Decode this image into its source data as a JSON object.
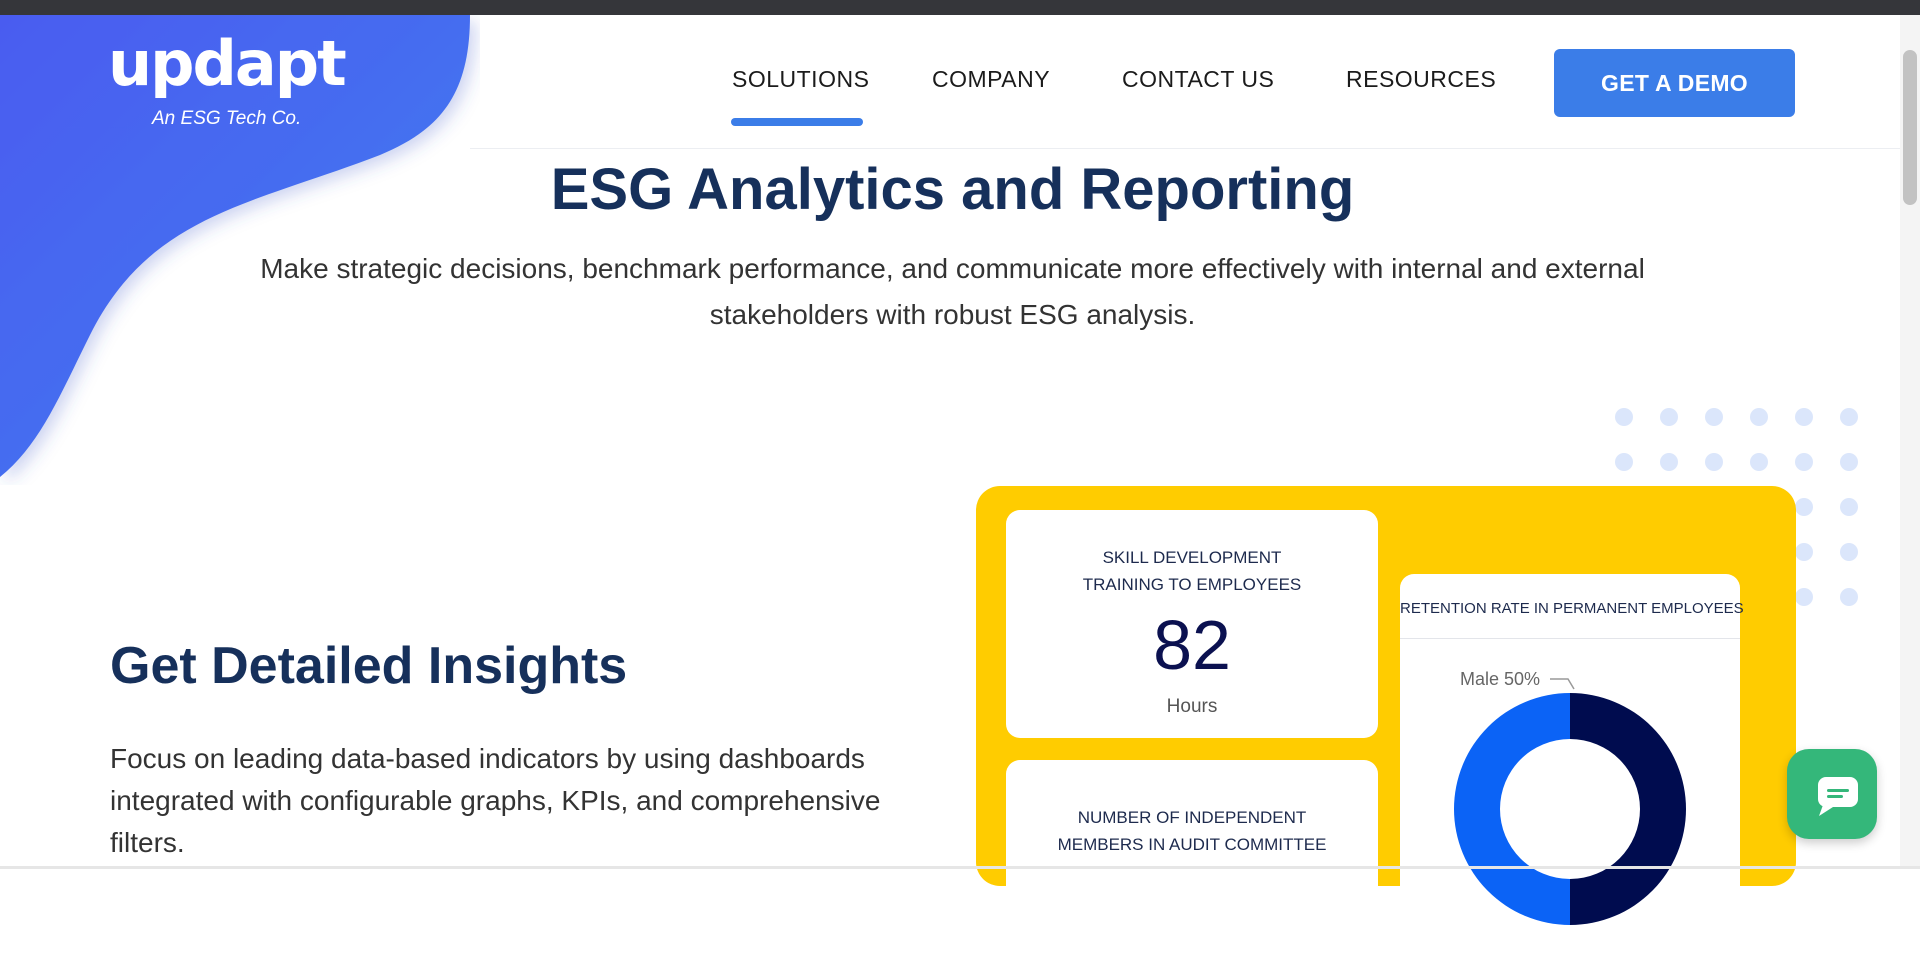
{
  "brand": {
    "logo_text": "updapt",
    "tagline": "An ESG Tech Co."
  },
  "nav": {
    "items": [
      {
        "label": "SOLUTIONS",
        "active": true
      },
      {
        "label": "COMPANY"
      },
      {
        "label": "CONTACT US"
      },
      {
        "label": "RESOURCES"
      }
    ],
    "cta_label": "GET A DEMO"
  },
  "hero": {
    "title": "ESG Analytics and Reporting",
    "subtitle": "Make strategic decisions, benchmark performance, and communicate more effectively with internal and external stakeholders with robust ESG analysis."
  },
  "section": {
    "title": "Get Detailed Insights",
    "description": "Focus on leading data-based indicators by using dashboards integrated with configurable graphs, KPIs, and comprehensive filters."
  },
  "dashboard": {
    "kpi_card": {
      "title": "SKILL DEVELOPMENT TRAINING TO EMPLOYEES",
      "value": "82",
      "unit": "Hours"
    },
    "members_card": {
      "title": "NUMBER OF INDEPENDENT MEMBERS IN AUDIT COMMITTEE"
    },
    "retention_card": {
      "title": "RETENTION RATE IN PERMANENT EMPLOYEES",
      "slice_label": "Male 50%"
    }
  },
  "chart_data": {
    "type": "pie",
    "title": "RETENTION RATE IN PERMANENT EMPLOYEES",
    "slices": [
      {
        "label": "Male",
        "value": 50,
        "color": "#000c4f"
      },
      {
        "value": 50,
        "color": "#0b63f6"
      }
    ]
  },
  "colors": {
    "brand_blue": "#3b7de8",
    "navy": "#16305b",
    "dashboard_yellow": "#ffcc00",
    "chat_green": "#34b77a"
  }
}
